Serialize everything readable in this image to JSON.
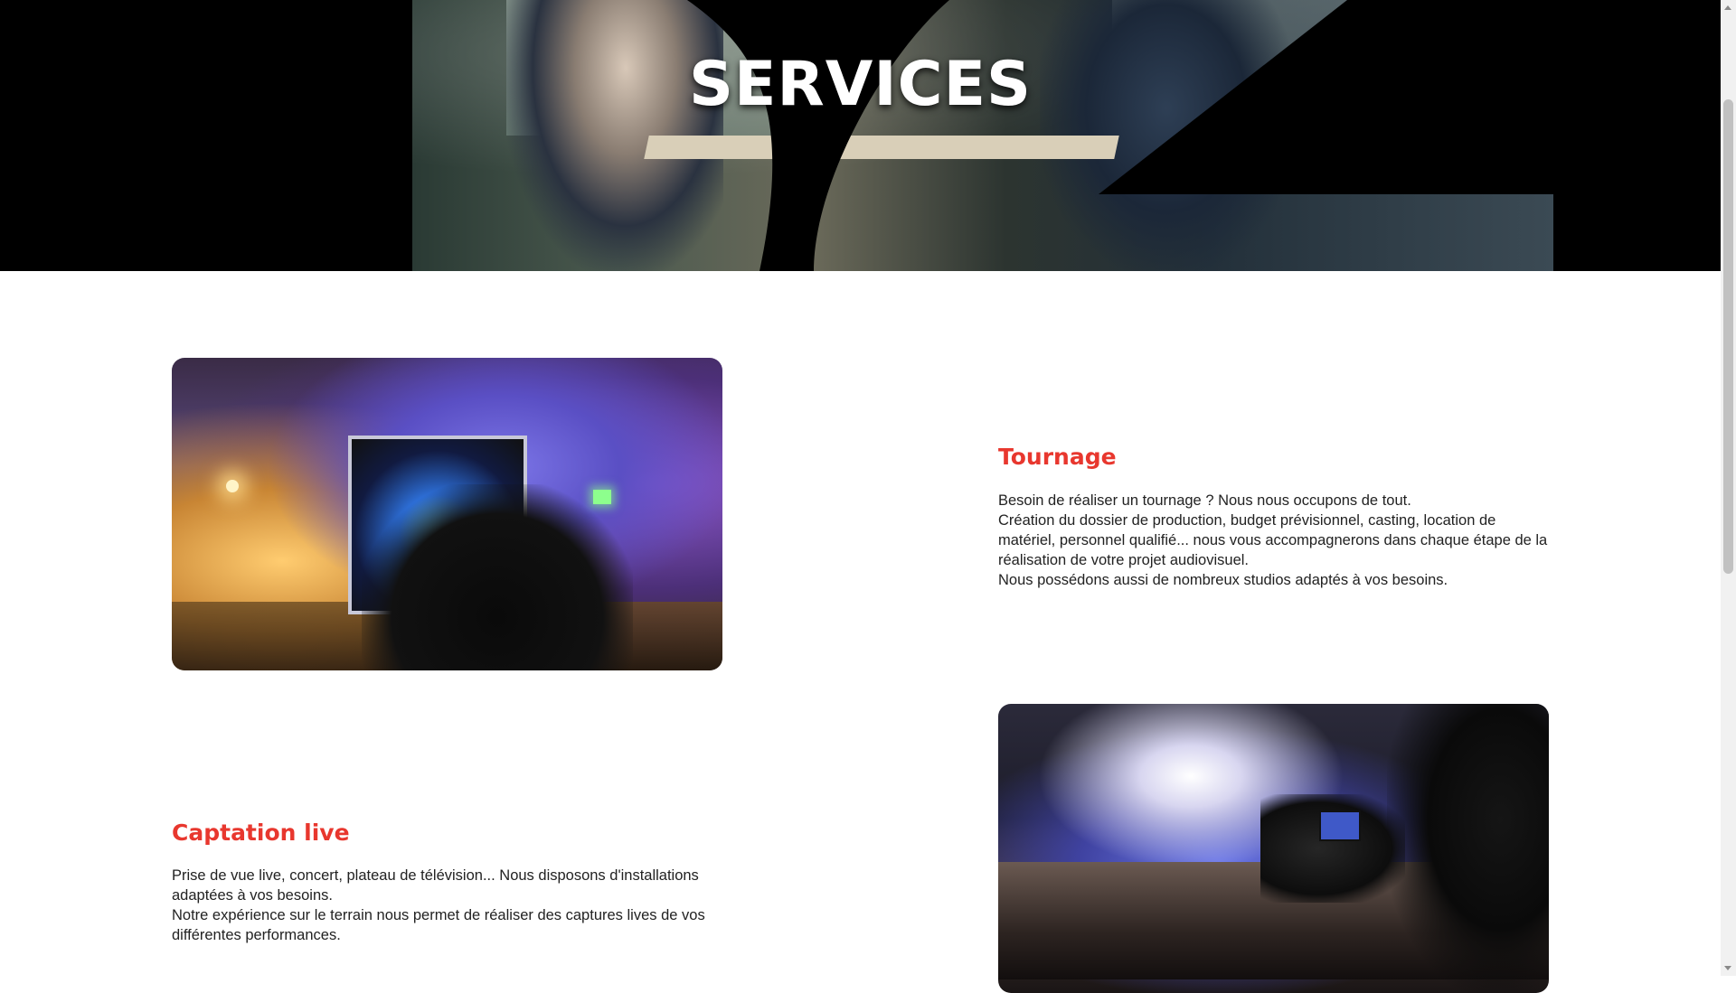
{
  "hero": {
    "title": "SERVICES"
  },
  "services": [
    {
      "title": "Tournage",
      "body": [
        "Besoin de réaliser un tournage ? Nous nous occupons de tout.",
        "Création du dossier de production, budget prévisionnel, casting, location de matériel, personnel qualifié... nous vous accompagnerons dans chaque étape de la réalisation de votre projet audiovisuel.",
        "Nous possédons aussi de nombreux studios adaptés à vos besoins."
      ]
    },
    {
      "title": "Captation live",
      "body": [
        "Prise de vue live, concert, plateau de télévision... Nous disposons d'installations adaptées à vos besoins.",
        "Notre expérience sur le terrain nous permet de réaliser des captures lives de vos différentes performances."
      ]
    }
  ],
  "colors": {
    "accent": "#e8372e",
    "hero_background": "#000000",
    "body_text": "#222222"
  }
}
